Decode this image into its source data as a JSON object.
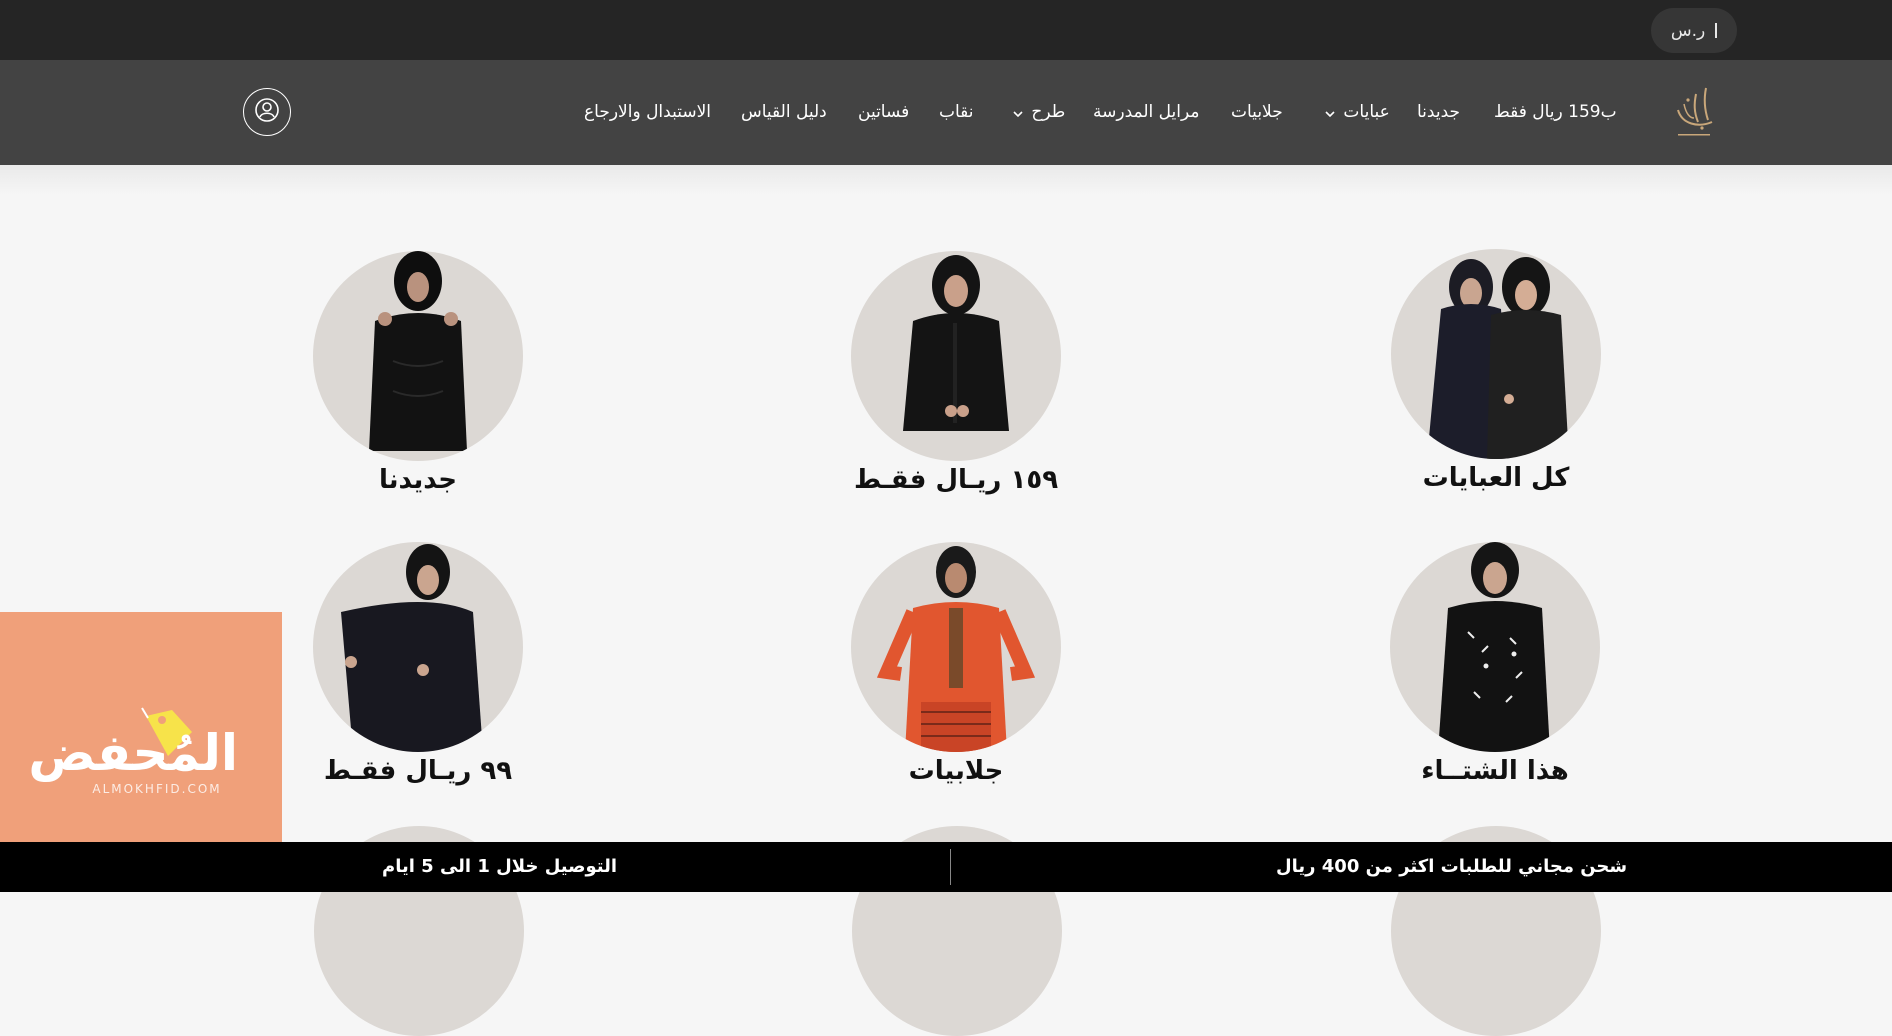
{
  "topbar": {
    "currency": "ر.س"
  },
  "logo": {
    "name": "brand-logo"
  },
  "nav": {
    "items": [
      {
        "label": "ب159 ريال فقط",
        "dropdown": false
      },
      {
        "label": "جديدنا",
        "dropdown": false
      },
      {
        "label": "عبايات",
        "dropdown": true
      },
      {
        "label": "جلابيات",
        "dropdown": false
      },
      {
        "label": "مرايل المدرسة",
        "dropdown": false
      },
      {
        "label": "طرح",
        "dropdown": true
      },
      {
        "label": "نقاب",
        "dropdown": false
      },
      {
        "label": "فساتين",
        "dropdown": false
      },
      {
        "label": "دليل القياس",
        "dropdown": false
      },
      {
        "label": "الاستبدال والارجاع",
        "dropdown": false
      }
    ],
    "account_icon": "user-circle-icon"
  },
  "categories": [
    {
      "label": "كل العبايات",
      "image": "two-women-abaya"
    },
    {
      "label": "١٥٩ ريـال فقـط",
      "image": "woman-black-abaya"
    },
    {
      "label": "جديدنا",
      "image": "woman-embroidered-abaya"
    },
    {
      "label": "هذا الشتــاء",
      "image": "woman-patterned-abaya"
    },
    {
      "label": "جلابيات",
      "image": "woman-orange-jalabiya"
    },
    {
      "label": "٩٩ ريـال فقـط",
      "image": "woman-wide-sleeve-abaya"
    }
  ],
  "watermark": {
    "text": "المُحفض",
    "domain": "ALMOKHFID.COM"
  },
  "banner": {
    "right_text": "شحن مجاني للطلبات اكثر من 400 ريال",
    "left_text": "التوصيل خلال 1 الى 5 ايام"
  },
  "colors": {
    "topbar": "#252525",
    "navbar": "#434343",
    "page_bg": "#f6f6f6",
    "circle_bg": "#dcd8d4",
    "watermark": "#f0a07a",
    "banner": "#000000"
  }
}
